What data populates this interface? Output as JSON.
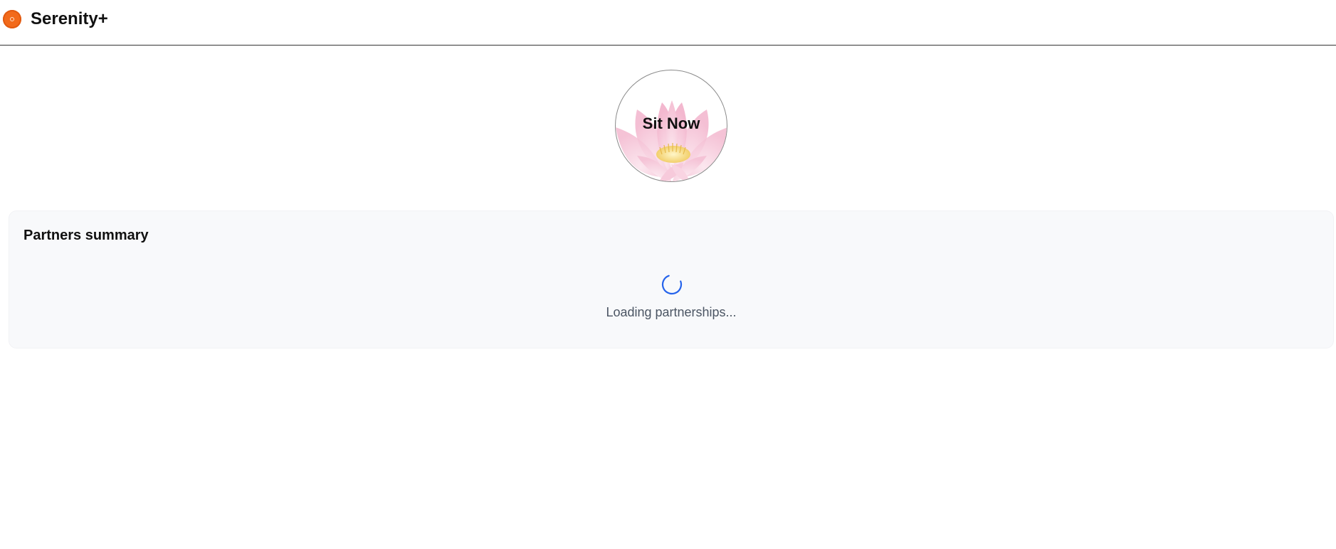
{
  "app": {
    "title": "Serenity+",
    "logo_icon": "orange-circle-logo-icon",
    "brand_color": "#f26a1b"
  },
  "hero": {
    "button_label": "Sit Now",
    "background_icon": "lotus-flower-icon"
  },
  "partners_panel": {
    "title": "Partners summary",
    "loading_text": "Loading partnerships...",
    "spinner_icon": "loading-spinner-icon",
    "spinner_color": "#2563eb"
  }
}
